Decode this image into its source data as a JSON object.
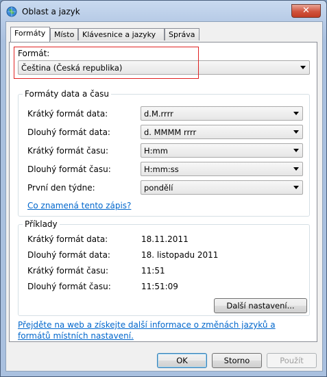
{
  "window": {
    "title": "Oblast a jazyk",
    "close_glyph": "✕"
  },
  "tabs": [
    {
      "label": "Formáty",
      "active": true
    },
    {
      "label": "Místo",
      "active": false
    },
    {
      "label": "Klávesnice a jazyky",
      "active": false
    },
    {
      "label": "Správa",
      "active": false
    }
  ],
  "format": {
    "label": "Formát:",
    "value": "Čeština (Česká republika)"
  },
  "datetime_group": {
    "title": "Formáty data a času",
    "rows": [
      {
        "label": "Krátký formát data:",
        "value": "d.M.rrrr"
      },
      {
        "label": "Dlouhý formát data:",
        "value": "d. MMMM rrrr"
      },
      {
        "label": "Krátký formát času:",
        "value": "H:mm"
      },
      {
        "label": "Dlouhý formát času:",
        "value": "H:mm:ss"
      },
      {
        "label": "První den týdne:",
        "value": "pondělí"
      }
    ],
    "help_link": "Co znamená tento zápis?"
  },
  "examples_group": {
    "title": "Příklady",
    "rows": [
      {
        "label": "Krátký formát data:",
        "value": "18.11.2011"
      },
      {
        "label": "Dlouhý formát data:",
        "value": "18. listopadu 2011"
      },
      {
        "label": "Krátký formát času:",
        "value": "11:51"
      },
      {
        "label": "Dlouhý formát času:",
        "value": "11:51:09"
      }
    ]
  },
  "more_settings_button": "Další nastavení...",
  "web_link": "Přejděte na web a získejte další informace o změnách jazyků a formátů místních nastavení.",
  "buttons": {
    "ok": "OK",
    "cancel": "Storno",
    "apply": "Použít"
  },
  "colors": {
    "highlight": "#e02020",
    "link": "#0066cc"
  }
}
